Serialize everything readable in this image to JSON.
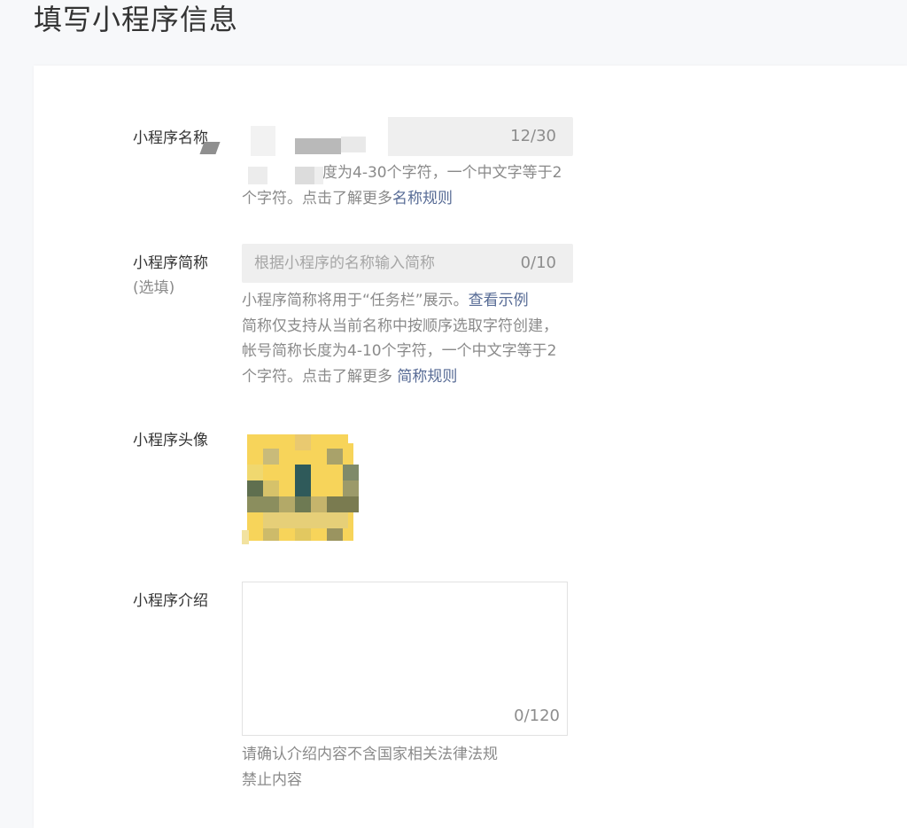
{
  "page": {
    "title": "填写小程序信息"
  },
  "name_field": {
    "label": "小程序名称",
    "counter": "12/30",
    "help_line1": "度为4-30个字符，一个中文字等于2",
    "help_line2_prefix": "个字符。点击了解更多",
    "help_link": "名称规则"
  },
  "short_name_field": {
    "label": "小程序简称",
    "optional": "(选填)",
    "placeholder": "根据小程序的名称输入简称",
    "counter": "0/10",
    "help_line1_prefix": "小程序简称将用于“任务栏”展示。",
    "help_line1_link": "查看示例",
    "help_line2": "简称仅支持从当前名称中按顺序选取字符创建，",
    "help_line3": "帐号简称长度为4-10个字符，一个中文字等于2",
    "help_line4_prefix": "个字符。点击了解更多 ",
    "help_line4_link": "简称规则"
  },
  "avatar_field": {
    "label": "小程序头像"
  },
  "intro_field": {
    "label": "小程序介绍",
    "counter": "0/120",
    "help_line1": "请确认介绍内容不含国家相关法律法规",
    "help_line2": "禁止内容"
  },
  "colors": {
    "background": "#f7f8fa",
    "card": "#ffffff",
    "link": "#576b95",
    "input_bg": "#efefef",
    "muted_text": "#8a8a8a"
  }
}
